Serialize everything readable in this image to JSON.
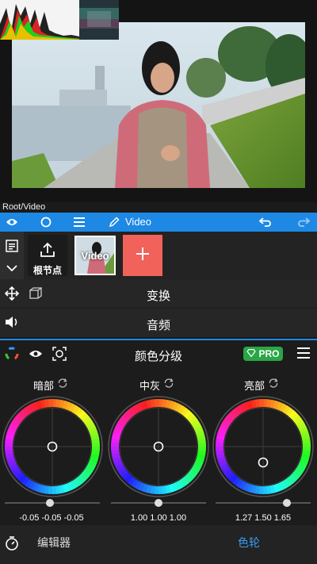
{
  "preview": {
    "path_label": "Root/Video"
  },
  "toolbar": {
    "title": "Video",
    "accent": "#1e88e5",
    "icons": [
      "eye-icon",
      "circle-icon",
      "menu-icon",
      "pencil-icon",
      "undo-icon",
      "redo-icon"
    ]
  },
  "layers": {
    "root_node_label": "根节点",
    "video_node_label": "Video",
    "add_color": "#f0625a"
  },
  "sections": {
    "transform_label": "变换",
    "audio_label": "音频"
  },
  "grading": {
    "title": "颜色分级",
    "pro_label": "PRO",
    "pro_color": "#29a745",
    "wheels": [
      {
        "label": "暗部",
        "values": "-0.05 -0.05 -0.05"
      },
      {
        "label": "中灰",
        "values": "1.00 1.00 1.00"
      },
      {
        "label": "亮部",
        "values": "1.27 1.50 1.65"
      }
    ]
  },
  "bottom": {
    "editor_label": "编辑器",
    "wheel_label": "色轮"
  }
}
